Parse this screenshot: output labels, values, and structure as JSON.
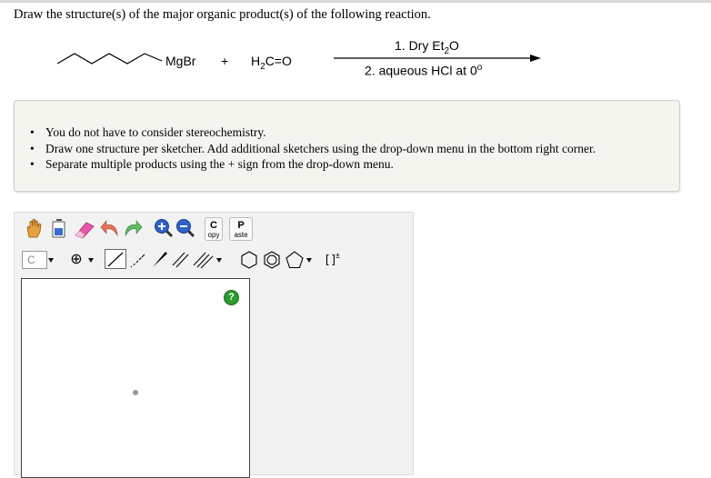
{
  "question": "Draw the structure(s) of the major organic product(s) of the following reaction.",
  "reaction": {
    "reagent1_label": "MgBr",
    "plus": "+",
    "reagent2": [
      "H",
      "2",
      "C=O"
    ],
    "condition1": [
      "1. Dry Et",
      "2",
      "O"
    ],
    "condition2": [
      "2. aqueous HCl at 0",
      "o"
    ]
  },
  "instructions": [
    "You do not have to consider stereochemistry.",
    "Draw one structure per sketcher. Add additional sketchers using the drop-down menu in the bottom right corner.",
    "Separate multiple products using the + sign from the drop-down menu."
  ],
  "bullet": "•",
  "sketcher": {
    "copy": {
      "top": "C",
      "bottom": "opy"
    },
    "paste": {
      "top": "P",
      "bottom": "aste"
    },
    "element": "C",
    "charge": "⊕",
    "bracket": "[ ]",
    "bracket_sup": "±",
    "help": "?"
  },
  "colors": {
    "infobox_bg": "#f5f5f0",
    "toolbar_bg": "#f2f2f2",
    "help_green": "#2e9b2e"
  }
}
